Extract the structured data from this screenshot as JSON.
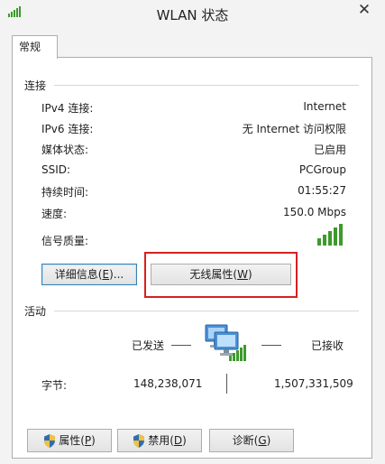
{
  "window": {
    "title": "WLAN 状态",
    "close_glyph": "✕",
    "title_icon": "signal-bars-icon"
  },
  "tabs": [
    {
      "label": "常规",
      "selected": true
    }
  ],
  "connection": {
    "heading": "连接",
    "rows": [
      {
        "label": "IPv4 连接:",
        "value": "Internet"
      },
      {
        "label": "IPv6 连接:",
        "value": "无 Internet 访问权限"
      },
      {
        "label": "媒体状态:",
        "value": "已启用"
      },
      {
        "label": "SSID:",
        "value": "PCGroup"
      },
      {
        "label": "持续时间:",
        "value": "01:55:27"
      },
      {
        "label": "速度:",
        "value": "150.0 Mbps"
      }
    ],
    "signal_label": "信号质量:",
    "signal_bars": 5,
    "signal_color": "#3d9a2d"
  },
  "buttons": {
    "details_prefix": "详细信息(",
    "details_key": "E",
    "details_suffix": ")...",
    "wireless_prefix": "无线属性(",
    "wireless_key": "W",
    "wireless_suffix": ")",
    "properties_prefix": "属性(",
    "properties_key": "P",
    "properties_suffix": ")",
    "disable_prefix": "禁用(",
    "disable_key": "D",
    "disable_suffix": ")",
    "diagnose_prefix": "诊断(",
    "diagnose_key": "G",
    "diagnose_suffix": ")"
  },
  "activity": {
    "heading": "活动",
    "sent_label": "已发送",
    "received_label": "已接收",
    "bytes_label": "字节:",
    "bytes_sent": "148,238,071",
    "bytes_received": "1,507,331,509"
  },
  "colors": {
    "highlight": "#d62020",
    "accent": "#3c7fb1"
  }
}
